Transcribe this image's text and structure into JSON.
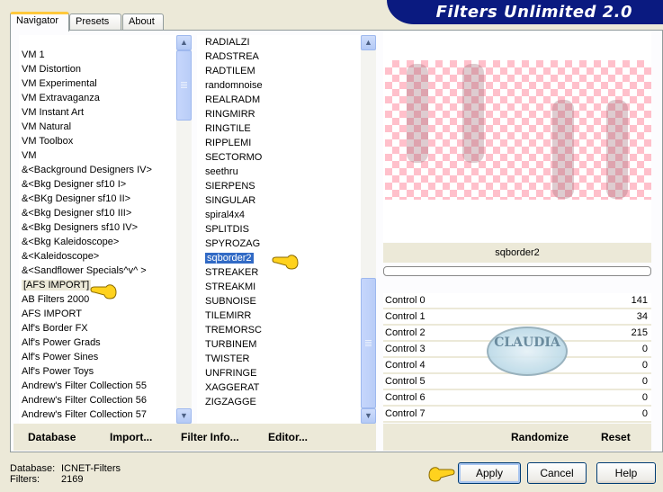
{
  "app": {
    "title": "Filters Unlimited 2.0"
  },
  "tabs": [
    {
      "label": "Navigator",
      "active": true
    },
    {
      "label": "Presets",
      "active": false
    },
    {
      "label": "About",
      "active": false
    }
  ],
  "categories": {
    "items": [
      "VM 1",
      "VM Distortion",
      "VM Experimental",
      "VM Extravaganza",
      "VM Instant Art",
      "VM Natural",
      "VM Toolbox",
      "VM",
      "&<Background Designers IV>",
      "&<Bkg Designer sf10 I>",
      "&<BKg Designer sf10 II>",
      "&<Bkg Designer sf10 III>",
      "&<Bkg Designers sf10 IV>",
      "&<Bkg Kaleidoscope>",
      "&<Kaleidoscope>",
      "&<Sandflower Specials^v^ >",
      "[AFS IMPORT]",
      "AB Filters 2000",
      "AFS IMPORT",
      "Alf's Border FX",
      "Alf's Power Grads",
      "Alf's Power Sines",
      "Alf's Power Toys",
      "Andrew's Filter Collection 55",
      "Andrew's Filter Collection 56",
      "Andrew's Filter Collection 57"
    ],
    "selected": "[AFS IMPORT]",
    "scroll_position": 0.55
  },
  "filters": {
    "items": [
      "RADIALZI",
      "RADSTREA",
      "RADTILEM",
      "randomnoise",
      "REALRADM",
      "RINGMIRR",
      "RINGTILE",
      "RIPPLEMI",
      "SECTORMO",
      "seethru",
      "SIERPENS",
      "SINGULAR",
      "spiral4x4",
      "SPLITDIS",
      "SPYROZAG",
      "sqborder2",
      "STREAKER",
      "STREAKMI",
      "SUBNOISE",
      "TILEMIRR",
      "TREMORSC",
      "TURBINEM",
      "TWISTER",
      "UNFRINGE",
      "XAGGERAT",
      "ZIGZAGGE"
    ],
    "selected": "sqborder2",
    "scroll_position": 1.0
  },
  "left_actions": {
    "database": "Database",
    "import": "Import...",
    "filter_info": "Filter Info...",
    "editor": "Editor..."
  },
  "preview": {
    "filter_name": "sqborder2",
    "progress": 0
  },
  "controls": [
    {
      "label": "Control 0",
      "value": "141"
    },
    {
      "label": "Control 1",
      "value": "34"
    },
    {
      "label": "Control 2",
      "value": "215"
    },
    {
      "label": "Control 3",
      "value": "0"
    },
    {
      "label": "Control 4",
      "value": "0"
    },
    {
      "label": "Control 5",
      "value": "0"
    },
    {
      "label": "Control 6",
      "value": "0"
    },
    {
      "label": "Control 7",
      "value": "0"
    }
  ],
  "right_actions": {
    "randomize": "Randomize",
    "reset": "Reset"
  },
  "status": {
    "database_label": "Database:",
    "database_value": "ICNET-Filters",
    "filters_label": "Filters:",
    "filters_value": "2169"
  },
  "buttons": {
    "apply": "Apply",
    "cancel": "Cancel",
    "help": "Help"
  },
  "watermark": {
    "text": "CLAUDIA"
  },
  "colors": {
    "banner": "#0A1A80",
    "selection": "#316AC5",
    "window_bg": "#ECE9D8",
    "checker_pink": "#FFC0CB"
  }
}
